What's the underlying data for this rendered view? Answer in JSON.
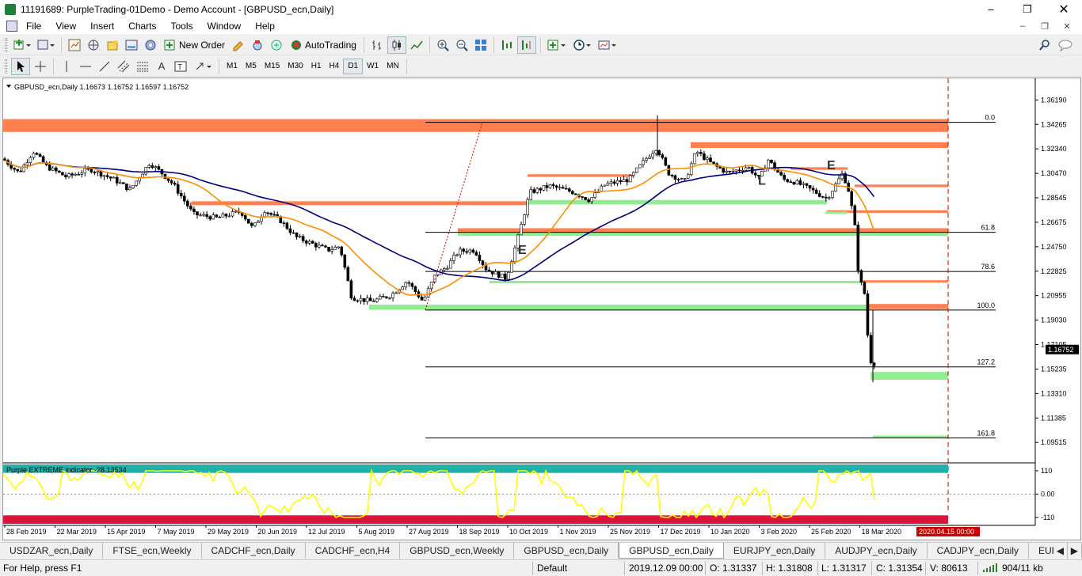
{
  "window": {
    "title": "11191689: PurpleTrading-01Demo - Demo Account - [GBPUSD_ecn,Daily]"
  },
  "menu": [
    "File",
    "View",
    "Insert",
    "Charts",
    "Tools",
    "Window",
    "Help"
  ],
  "toolbar": {
    "new_order": "New Order",
    "autotrading": "AutoTrading"
  },
  "timeframes": [
    "M1",
    "M5",
    "M15",
    "M30",
    "H1",
    "H4",
    "D1",
    "W1",
    "MN"
  ],
  "active_timeframe": "D1",
  "chart": {
    "header": "GBPUSD_ecn,Daily  1.16673 1.16752 1.16597 1.16752",
    "price_labels": [
      "1.36190",
      "1.34265",
      "1.32340",
      "1.30470",
      "1.28545",
      "1.26675",
      "1.24750",
      "1.22825",
      "1.20955",
      "1.19030",
      "1.17105",
      "1.15235",
      "1.13310",
      "1.11385",
      "1.09515"
    ],
    "price_min": 1.0885,
    "price_max": 1.3695,
    "current_price": "1.16752",
    "current_value": 1.16752,
    "date_labels": [
      "28 Feb 2019",
      "22 Mar 2019",
      "15 Apr 2019",
      "7 May 2019",
      "29 May 2019",
      "20 Jun 2019",
      "12 Jul 2019",
      "5 Aug 2019",
      "27 Aug 2019",
      "18 Sep 2019",
      "10 Oct 2019",
      "1 Nov 2019",
      "25 Nov 2019",
      "17 Dec 2019",
      "10 Jan 2020",
      "3 Feb 2020",
      "25 Feb 2020",
      "18 Mar 2020"
    ],
    "future_date": "2020.04.15 00:00",
    "fib_levels": [
      {
        "label": "0.0",
        "price": 1.3445
      },
      {
        "label": "61.8",
        "price": 1.2588
      },
      {
        "label": "78.6",
        "price": 1.2283
      },
      {
        "label": "100.0",
        "price": 1.1983
      },
      {
        "label": "127.2",
        "price": 1.154
      },
      {
        "label": "161.8",
        "price": 1.0987
      }
    ],
    "letters": [
      "E",
      "L",
      "E"
    ],
    "colors": {
      "supply": "#ff7f50",
      "demand": "#90ee90",
      "ma_fast": "#ff8c00",
      "ma_slow": "#000080",
      "candle": "#000000",
      "fib": "#000000",
      "separator": "#cc0000"
    },
    "indicator": {
      "label": "Purple EXTREME indicator -28.13534",
      "levels": [
        "110",
        "0.00",
        "-110"
      ],
      "value": -28.13534,
      "colors": {
        "top": "#20b2aa",
        "bottom": "#dc143c",
        "line": "#ffff00"
      }
    }
  },
  "tabs": [
    "USDZAR_ecn,Daily",
    "FTSE_ecn,Weekly",
    "CADCHF_ecn,Daily",
    "CADCHF_ecn,H4",
    "GBPUSD_ecn,Weekly",
    "GBPUSD_ecn,Daily",
    "GBPUSD_ecn,Daily",
    "EURJPY_ecn,Daily",
    "AUDJPY_ecn,Daily",
    "CADJPY_ecn,Daily",
    "EURUSD_ecn,Daily"
  ],
  "active_tab": 6,
  "status": {
    "help": "For Help, press F1",
    "profile": "Default",
    "datetime": "2019.12.09 00:00",
    "open": "O: 1.31337",
    "high": "H: 1.31808",
    "low": "L: 1.31317",
    "close": "C: 1.31354",
    "volume": "V: 80613",
    "traffic": "904/11 kb"
  }
}
